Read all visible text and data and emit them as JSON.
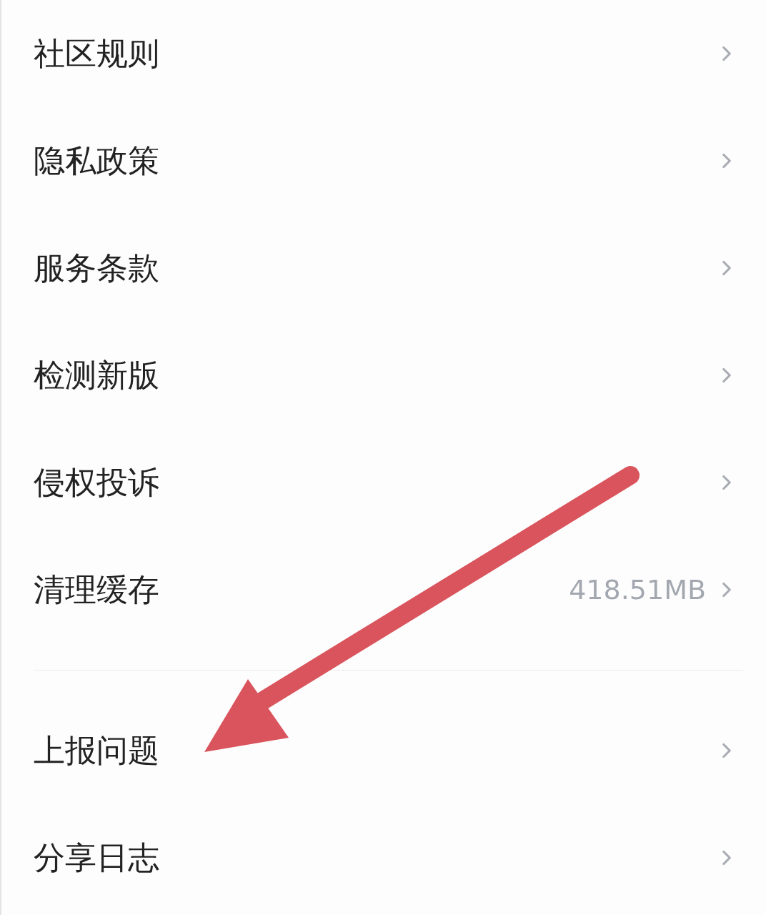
{
  "sections": [
    {
      "items": [
        {
          "label": "社区规则"
        },
        {
          "label": "隐私政策"
        },
        {
          "label": "服务条款"
        },
        {
          "label": "检测新版"
        },
        {
          "label": "侵权投诉"
        },
        {
          "label": "清理缓存",
          "value": "418.51MB"
        }
      ]
    },
    {
      "items": [
        {
          "label": "上报问题"
        },
        {
          "label": "分享日志"
        }
      ]
    }
  ]
}
